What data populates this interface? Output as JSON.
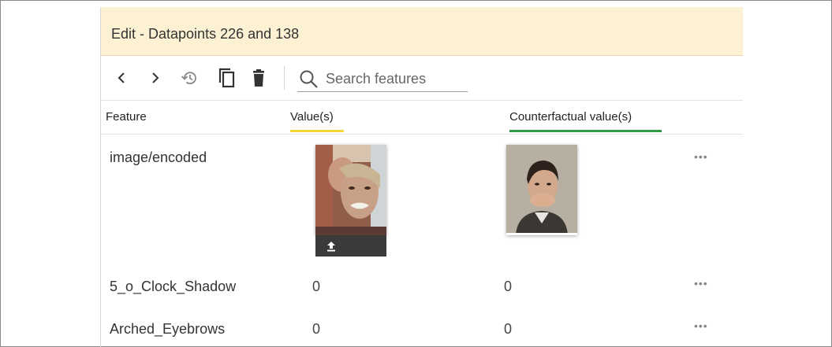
{
  "header": {
    "title": "Edit - Datapoints 226 and 138"
  },
  "toolbar": {
    "search_placeholder": "Search features"
  },
  "columns": {
    "feature": "Feature",
    "values": "Value(s)",
    "counterfactual": "Counterfactual value(s)",
    "values_accent": "#f5d638",
    "counterfactual_accent": "#2e9d46"
  },
  "rows": [
    {
      "feature": "image/encoded",
      "value": "",
      "counterfactual": ""
    },
    {
      "feature": "5_o_Clock_Shadow",
      "value": "0",
      "counterfactual": "0"
    },
    {
      "feature": "Arched_Eyebrows",
      "value": "0",
      "counterfactual": "0"
    }
  ],
  "more_label": "•••"
}
